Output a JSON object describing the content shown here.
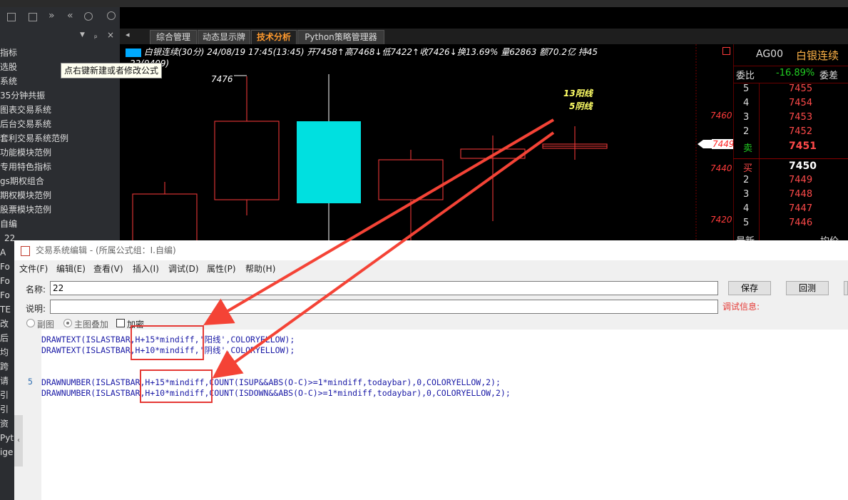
{
  "tooltip": "点右键新建或者修改公式",
  "left_panel": {
    "items": [
      "指标",
      "选股",
      "系统",
      "35分钟共振",
      "图表交易系统",
      "后台交易系统",
      "套利交易系统范例",
      "功能模块范例",
      "专用特色指标",
      "gs期权组合",
      "期权模块范例",
      "股票模块范例",
      "自编",
      "22",
      "A",
      "Fo",
      "Fo",
      "Fo",
      "TE",
      "改",
      "后",
      "均",
      "跨",
      "请",
      "引",
      "引",
      "资",
      "Pyth",
      "ige"
    ]
  },
  "tabs": [
    "综合管理",
    "动态显示牌",
    "技术分析",
    "Python策略管理器"
  ],
  "chart": {
    "info_line": "白银连续(30分) 24/08/19 17:45(13:45) 开7458↑高7468↓低7422↑收7426↓换13.69% 量62863 额70.2亿 持45",
    "info_line2": "22(9409)",
    "labels": {
      "high_mark": "7476",
      "yang": "13阳线",
      "yin": "5阴线"
    },
    "price_axis": [
      "7460",
      "7449",
      "7440",
      "7420"
    ],
    "colors": {
      "up": "#ff3b3b",
      "down": "#00e0e0",
      "text_yellow": "#ffff66"
    }
  },
  "quote": {
    "code": "AG00",
    "name": "白银连续",
    "ratio_label": "委比",
    "ratio_value": "-16.89%",
    "diff_label": "委差",
    "asks": [
      {
        "lvl": "5",
        "price": "7455"
      },
      {
        "lvl": "4",
        "price": "7454"
      },
      {
        "lvl": "3",
        "price": "7453"
      },
      {
        "lvl": "2",
        "price": "7452"
      },
      {
        "lvl": "卖",
        "price": "7451"
      }
    ],
    "bids": [
      {
        "lvl": "买",
        "price": "7450"
      },
      {
        "lvl": "2",
        "price": "7449"
      },
      {
        "lvl": "3",
        "price": "7448"
      },
      {
        "lvl": "4",
        "price": "7447"
      },
      {
        "lvl": "5",
        "price": "7446"
      }
    ],
    "last_label": "最新",
    "avg_label": "均价"
  },
  "dialog": {
    "title": "交易系统编辑 - (所属公式组：I.自编)",
    "menu": [
      "文件(F)",
      "编辑(E)",
      "查看(V)",
      "插入(I)",
      "调试(D)",
      "属性(P)",
      "帮助(H)"
    ],
    "name_label": "名称:",
    "name_value": "22",
    "desc_label": "说明:",
    "debug_label": "调试信息:",
    "save_btn": "保存",
    "back_btn": "回测",
    "radio_sub": "副图",
    "radio_main": "主图叠加",
    "encrypt": "加密",
    "line_number": "5",
    "code": [
      "DRAWTEXT(ISLASTBAR,H+15*mindiff,'阳线',COLORYELLOW);",
      "DRAWTEXT(ISLASTBAR,H+10*mindiff,'阴线',COLORYELLOW);",
      "DRAWNUMBER(ISLASTBAR,H+15*mindiff,COUNT(ISUP&&ABS(O-C)>=1*mindiff,todaybar),0,COLORYELLOW,2);",
      "DRAWNUMBER(ISLASTBAR,H+10*mindiff,COUNT(ISDOWN&&ABS(O-C)>=1*mindiff,todaybar),0,COLORYELLOW,2);"
    ]
  }
}
